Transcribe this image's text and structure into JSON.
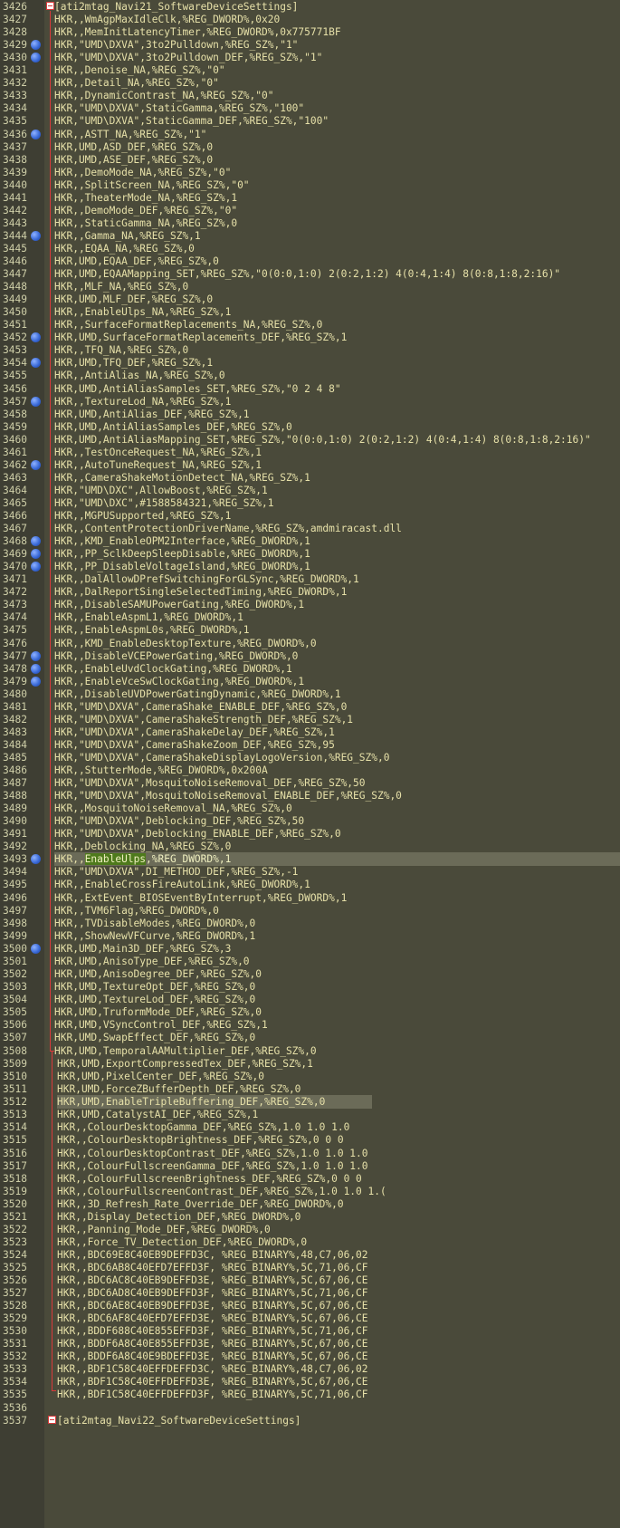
{
  "editor": {
    "lines": [
      {
        "n": "3426",
        "t": "[ati2mtag_Navi21_SoftwareDeviceSettings]",
        "bm": false,
        "fold": true
      },
      {
        "n": "3427",
        "t": "HKR,,WmAgpMaxIdleClk,%REG_DWORD%,0x20",
        "bm": false
      },
      {
        "n": "3428",
        "t": "HKR,,MemInitLatencyTimer,%REG_DWORD%,0x775771BF",
        "bm": false
      },
      {
        "n": "3429",
        "t": "HKR,\"UMD\\DXVA\",3to2Pulldown,%REG_SZ%,\"1\"",
        "bm": true
      },
      {
        "n": "3430",
        "t": "HKR,\"UMD\\DXVA\",3to2Pulldown_DEF,%REG_SZ%,\"1\"",
        "bm": true
      },
      {
        "n": "3431",
        "t": "HKR,,Denoise_NA,%REG_SZ%,\"0\"",
        "bm": false
      },
      {
        "n": "3432",
        "t": "HKR,,Detail_NA,%REG_SZ%,\"0\"",
        "bm": false
      },
      {
        "n": "3433",
        "t": "HKR,,DynamicContrast_NA,%REG_SZ%,\"0\"",
        "bm": false
      },
      {
        "n": "3434",
        "t": "HKR,\"UMD\\DXVA\",StaticGamma,%REG_SZ%,\"100\"",
        "bm": false
      },
      {
        "n": "3435",
        "t": "HKR,\"UMD\\DXVA\",StaticGamma_DEF,%REG_SZ%,\"100\"",
        "bm": false
      },
      {
        "n": "3436",
        "t": "HKR,,ASTT_NA,%REG_SZ%,\"1\"",
        "bm": true
      },
      {
        "n": "3437",
        "t": "HKR,UMD,ASD_DEF,%REG_SZ%,0",
        "bm": false
      },
      {
        "n": "3438",
        "t": "HKR,UMD,ASE_DEF,%REG_SZ%,0",
        "bm": false
      },
      {
        "n": "3439",
        "t": "HKR,,DemoMode_NA,%REG_SZ%,\"0\"",
        "bm": false
      },
      {
        "n": "3440",
        "t": "HKR,,SplitScreen_NA,%REG_SZ%,\"0\"",
        "bm": false
      },
      {
        "n": "3441",
        "t": "HKR,,TheaterMode_NA,%REG_SZ%,1",
        "bm": false
      },
      {
        "n": "3442",
        "t": "HKR,,DemoMode_DEF,%REG_SZ%,\"0\"",
        "bm": false
      },
      {
        "n": "3443",
        "t": "HKR,,StaticGamma_NA,%REG_SZ%,0",
        "bm": false
      },
      {
        "n": "3444",
        "t": "HKR,,Gamma_NA,%REG_SZ%,1",
        "bm": true
      },
      {
        "n": "3445",
        "t": "HKR,,EQAA_NA,%REG_SZ%,0",
        "bm": false
      },
      {
        "n": "3446",
        "t": "HKR,UMD,EQAA_DEF,%REG_SZ%,0",
        "bm": false
      },
      {
        "n": "3447",
        "t": "HKR,UMD,EQAAMapping_SET,%REG_SZ%,\"0(0:0,1:0) 2(0:2,1:2) 4(0:4,1:4) 8(0:8,1:8,2:16)\"",
        "bm": false
      },
      {
        "n": "3448",
        "t": "HKR,,MLF_NA,%REG_SZ%,0",
        "bm": false
      },
      {
        "n": "3449",
        "t": "HKR,UMD,MLF_DEF,%REG_SZ%,0",
        "bm": false
      },
      {
        "n": "3450",
        "t": "HKR,,EnableUlps_NA,%REG_SZ%,1",
        "bm": false
      },
      {
        "n": "3451",
        "t": "HKR,,SurfaceFormatReplacements_NA,%REG_SZ%,0",
        "bm": false
      },
      {
        "n": "3452",
        "t": "HKR,UMD,SurfaceFormatReplacements_DEF,%REG_SZ%,1",
        "bm": true
      },
      {
        "n": "3453",
        "t": "HKR,,TFQ_NA,%REG_SZ%,0",
        "bm": false
      },
      {
        "n": "3454",
        "t": "HKR,UMD,TFQ_DEF,%REG_SZ%,1",
        "bm": true
      },
      {
        "n": "3455",
        "t": "HKR,,AntiAlias_NA,%REG_SZ%,0",
        "bm": false
      },
      {
        "n": "3456",
        "t": "HKR,UMD,AntiAliasSamples_SET,%REG_SZ%,\"0 2 4 8\"",
        "bm": false
      },
      {
        "n": "3457",
        "t": "HKR,,TextureLod_NA,%REG_SZ%,1",
        "bm": true
      },
      {
        "n": "3458",
        "t": "HKR,UMD,AntiAlias_DEF,%REG_SZ%,1",
        "bm": false
      },
      {
        "n": "3459",
        "t": "HKR,UMD,AntiAliasSamples_DEF,%REG_SZ%,0",
        "bm": false
      },
      {
        "n": "3460",
        "t": "HKR,UMD,AntiAliasMapping_SET,%REG_SZ%,\"0(0:0,1:0) 2(0:2,1:2) 4(0:4,1:4) 8(0:8,1:8,2:16)\"",
        "bm": false
      },
      {
        "n": "3461",
        "t": "HKR,,TestOnceRequest_NA,%REG_SZ%,1",
        "bm": false
      },
      {
        "n": "3462",
        "t": "HKR,,AutoTuneRequest_NA,%REG_SZ%,1",
        "bm": true
      },
      {
        "n": "3463",
        "t": "HKR,,CameraShakeMotionDetect_NA,%REG_SZ%,1",
        "bm": false
      },
      {
        "n": "3464",
        "t": "HKR,\"UMD\\DXC\",AllowBoost,%REG_SZ%,1",
        "bm": false
      },
      {
        "n": "3465",
        "t": "HKR,\"UMD\\DXC\",#1588584321,%REG_SZ%,1",
        "bm": false
      },
      {
        "n": "3466",
        "t": "HKR,,MGPUSupported,%REG_SZ%,1",
        "bm": false
      },
      {
        "n": "3467",
        "t": "HKR,,ContentProtectionDriverName,%REG_SZ%,amdmiracast.dll",
        "bm": false
      },
      {
        "n": "3468",
        "t": "HKR,,KMD_EnableOPM2Interface,%REG_DWORD%,1",
        "bm": true
      },
      {
        "n": "3469",
        "t": "HKR,,PP_SclkDeepSleepDisable,%REG_DWORD%,1",
        "bm": true
      },
      {
        "n": "3470",
        "t": "HKR,,PP_DisableVoltageIsland,%REG_DWORD%,1",
        "bm": true
      },
      {
        "n": "3471",
        "t": "HKR,,DalAllowDPrefSwitchingForGLSync,%REG_DWORD%,1",
        "bm": false
      },
      {
        "n": "3472",
        "t": "HKR,,DalReportSingleSelectedTiming,%REG_DWORD%,1",
        "bm": false
      },
      {
        "n": "3473",
        "t": "HKR,,DisableSAMUPowerGating,%REG_DWORD%,1",
        "bm": false
      },
      {
        "n": "3474",
        "t": "HKR,,EnableAspmL1,%REG_DWORD%,1",
        "bm": false
      },
      {
        "n": "3475",
        "t": "HKR,,EnableAspmL0s,%REG_DWORD%,1",
        "bm": false
      },
      {
        "n": "3476",
        "t": "HKR,,KMD_EnableDesktopTexture,%REG_DWORD%,0",
        "bm": false
      },
      {
        "n": "3477",
        "t": "HKR,,DisableVCEPowerGating,%REG_DWORD%,0",
        "bm": true
      },
      {
        "n": "3478",
        "t": "HKR,,EnableUvdClockGating,%REG_DWORD%,1",
        "bm": true
      },
      {
        "n": "3479",
        "t": "HKR,,EnableVceSwClockGating,%REG_DWORD%,1",
        "bm": true
      },
      {
        "n": "3480",
        "t": "HKR,,DisableUVDPowerGatingDynamic,%REG_DWORD%,1",
        "bm": false
      },
      {
        "n": "3481",
        "t": "HKR,\"UMD\\DXVA\",CameraShake_ENABLE_DEF,%REG_SZ%,0",
        "bm": false
      },
      {
        "n": "3482",
        "t": "HKR,\"UMD\\DXVA\",CameraShakeStrength_DEF,%REG_SZ%,1",
        "bm": false
      },
      {
        "n": "3483",
        "t": "HKR,\"UMD\\DXVA\",CameraShakeDelay_DEF,%REG_SZ%,1",
        "bm": false
      },
      {
        "n": "3484",
        "t": "HKR,\"UMD\\DXVA\",CameraShakeZoom_DEF,%REG_SZ%,95",
        "bm": false
      },
      {
        "n": "3485",
        "t": "HKR,\"UMD\\DXVA\",CameraShakeDisplayLogoVersion,%REG_SZ%,0",
        "bm": false
      },
      {
        "n": "3486",
        "t": "HKR,,StutterMode,%REG_DWORD%,0x200A",
        "bm": false
      },
      {
        "n": "3487",
        "t": "HKR,\"UMD\\DXVA\",MosquitoNoiseRemoval_DEF,%REG_SZ%,50",
        "bm": false
      },
      {
        "n": "3488",
        "t": "HKR,\"UMD\\DXVA\",MosquitoNoiseRemoval_ENABLE_DEF,%REG_SZ%,0",
        "bm": false
      },
      {
        "n": "3489",
        "t": "HKR,,MosquitoNoiseRemoval_NA,%REG_SZ%,0",
        "bm": false
      },
      {
        "n": "3490",
        "t": "HKR,\"UMD\\DXVA\",Deblocking_DEF,%REG_SZ%,50",
        "bm": false
      },
      {
        "n": "3491",
        "t": "HKR,\"UMD\\DXVA\",Deblocking_ENABLE_DEF,%REG_SZ%,0",
        "bm": false
      },
      {
        "n": "3492",
        "t": "HKR,,Deblocking_NA,%REG_SZ%,0",
        "bm": false
      },
      {
        "n": "3493",
        "t": "HKR,,EnableUlps,%REG_DWORD%,1",
        "bm": true,
        "hl": 1
      },
      {
        "n": "3494",
        "t": "HKR,\"UMD\\DXVA\",DI_METHOD_DEF,%REG_SZ%,-1",
        "bm": false
      },
      {
        "n": "3495",
        "t": "HKR,,EnableCrossFireAutoLink,%REG_DWORD%,1",
        "bm": false
      },
      {
        "n": "3496",
        "t": "HKR,,ExtEvent_BIOSEventByInterrupt,%REG_DWORD%,1",
        "bm": false
      },
      {
        "n": "3497",
        "t": "HKR,,TVM6Flag,%REG_DWORD%,0",
        "bm": false
      },
      {
        "n": "3498",
        "t": "HKR,,TVDisableModes,%REG_DWORD%,0",
        "bm": false
      },
      {
        "n": "3499",
        "t": "HKR,,ShowNewVFCurve,%REG_DWORD%,1",
        "bm": false
      },
      {
        "n": "3500",
        "t": "HKR,UMD,Main3D_DEF,%REG_SZ%,3",
        "bm": true
      },
      {
        "n": "3501",
        "t": "HKR,UMD,AnisoType_DEF,%REG_SZ%,0",
        "bm": false
      },
      {
        "n": "3502",
        "t": "HKR,UMD,AnisoDegree_DEF,%REG_SZ%,0",
        "bm": false
      },
      {
        "n": "3503",
        "t": "HKR,UMD,TextureOpt_DEF,%REG_SZ%,0",
        "bm": false
      },
      {
        "n": "3504",
        "t": "HKR,UMD,TextureLod_DEF,%REG_SZ%,0",
        "bm": false
      },
      {
        "n": "3505",
        "t": "HKR,UMD,TruformMode_DEF,%REG_SZ%,0",
        "bm": false
      },
      {
        "n": "3506",
        "t": "HKR,UMD,VSyncControl_DEF,%REG_SZ%,1",
        "bm": false
      },
      {
        "n": "3507",
        "t": "HKR,UMD,SwapEffect_DEF,%REG_SZ%,0",
        "bm": false
      },
      {
        "n": "3508",
        "t": "HKR,UMD,TemporalAAMultiplier_DEF,%REG_SZ%,0",
        "bm": false
      },
      {
        "n": "3509",
        "t": "HKR,UMD,ExportCompressedTex_DEF,%REG_SZ%,1",
        "bm": false,
        "shift": true
      },
      {
        "n": "3510",
        "t": "HKR,UMD,PixelCenter_DEF,%REG_SZ%,0",
        "bm": false,
        "shift": true
      },
      {
        "n": "3511",
        "t": "HKR,UMD,ForceZBufferDepth_DEF,%REG_SZ%,0",
        "bm": false,
        "shift": true
      },
      {
        "n": "3512",
        "t": "HKR,UMD,EnableTripleBuffering_DEF,%REG_SZ%,0",
        "bm": false,
        "shift": true,
        "hl": 2
      },
      {
        "n": "3513",
        "t": "HKR,UMD,CatalystAI_DEF,%REG_SZ%,1",
        "bm": false,
        "shift": true
      },
      {
        "n": "3514",
        "t": "HKR,,ColourDesktopGamma_DEF,%REG_SZ%,1.0 1.0 1.0",
        "bm": false,
        "shift": true
      },
      {
        "n": "3515",
        "t": "HKR,,ColourDesktopBrightness_DEF,%REG_SZ%,0 0 0",
        "bm": false,
        "shift": true
      },
      {
        "n": "3516",
        "t": "HKR,,ColourDesktopContrast_DEF,%REG_SZ%,1.0 1.0 1.0",
        "bm": false,
        "shift": true
      },
      {
        "n": "3517",
        "t": "HKR,,ColourFullscreenGamma_DEF,%REG_SZ%,1.0 1.0 1.0",
        "bm": false,
        "shift": true
      },
      {
        "n": "3518",
        "t": "HKR,,ColourFullscreenBrightness_DEF,%REG_SZ%,0 0 0",
        "bm": false,
        "shift": true
      },
      {
        "n": "3519",
        "t": "HKR,,ColourFullscreenContrast_DEF,%REG_SZ%,1.0 1.0 1.(",
        "bm": false,
        "shift": true
      },
      {
        "n": "3520",
        "t": "HKR,,3D_Refresh_Rate_Override_DEF,%REG_DWORD%,0",
        "bm": false,
        "shift": true
      },
      {
        "n": "3521",
        "t": "HKR,,Display_Detection_DEF,%REG_DWORD%,0",
        "bm": false,
        "shift": true
      },
      {
        "n": "3522",
        "t": "HKR,,Panning_Mode_DEF,%REG_DWORD%,0",
        "bm": false,
        "shift": true
      },
      {
        "n": "3523",
        "t": "HKR,,Force_TV_Detection_DEF,%REG_DWORD%,0",
        "bm": false,
        "shift": true
      },
      {
        "n": "3524",
        "t": "HKR,,BDC69E8C40EB9DEFFD3C, %REG_BINARY%,48,C7,06,02",
        "bm": false,
        "shift": true
      },
      {
        "n": "3525",
        "t": "HKR,,BDC6AB8C40EFD7EFFD3F, %REG_BINARY%,5C,71,06,CF",
        "bm": false,
        "shift": true
      },
      {
        "n": "3526",
        "t": "HKR,,BDC6AC8C40EB9DEFFD3E, %REG_BINARY%,5C,67,06,CE",
        "bm": false,
        "shift": true
      },
      {
        "n": "3527",
        "t": "HKR,,BDC6AD8C40EB9DEFFD3F, %REG_BINARY%,5C,71,06,CF",
        "bm": false,
        "shift": true
      },
      {
        "n": "3528",
        "t": "HKR,,BDC6AE8C40EB9DEFFD3E, %REG_BINARY%,5C,67,06,CE",
        "bm": false,
        "shift": true
      },
      {
        "n": "3529",
        "t": "HKR,,BDC6AF8C40EFD7EFFD3E, %REG_BINARY%,5C,67,06,CE",
        "bm": false,
        "shift": true
      },
      {
        "n": "3530",
        "t": "HKR,,BDDF688C40E855EFFD3F, %REG_BINARY%,5C,71,06,CF",
        "bm": false,
        "shift": true
      },
      {
        "n": "3531",
        "t": "HKR,,BDDF6A8C40E855EFFD3E, %REG_BINARY%,5C,67,06,CE",
        "bm": false,
        "shift": true
      },
      {
        "n": "3532",
        "t": "HKR,,BDDF6A8C40E9BDEFFD3E, %REG_BINARY%,5C,67,06,CE",
        "bm": false,
        "shift": true
      },
      {
        "n": "3533",
        "t": "HKR,,BDF1C58C40EFFDEFFD3C, %REG_BINARY%,48,C7,06,02",
        "bm": false,
        "shift": true
      },
      {
        "n": "3534",
        "t": "HKR,,BDF1C58C40EFFDEFFD3E, %REG_BINARY%,5C,67,06,CE",
        "bm": false,
        "shift": true
      },
      {
        "n": "3535",
        "t": "HKR,,BDF1C58C40EFFDEFFD3F, %REG_BINARY%,5C,71,06,CF",
        "bm": false,
        "shift": true
      },
      {
        "n": "3536",
        "t": "",
        "bm": false,
        "shift": true
      },
      {
        "n": "3537",
        "t": "[ati2mtag_Navi22_SoftwareDeviceSettings]",
        "bm": false,
        "fold": true,
        "shift": true
      }
    ],
    "highlight_word": "EnableUlps",
    "colors": {
      "background": "#4a4a3a",
      "text": "#e6e0a8",
      "line_number": "#cfcfa8",
      "bookmark": "#3a6ad8",
      "fold_marker": "#d83a3a",
      "current_line": "#6b6b58",
      "match_highlight": "#4e7a1c"
    }
  }
}
